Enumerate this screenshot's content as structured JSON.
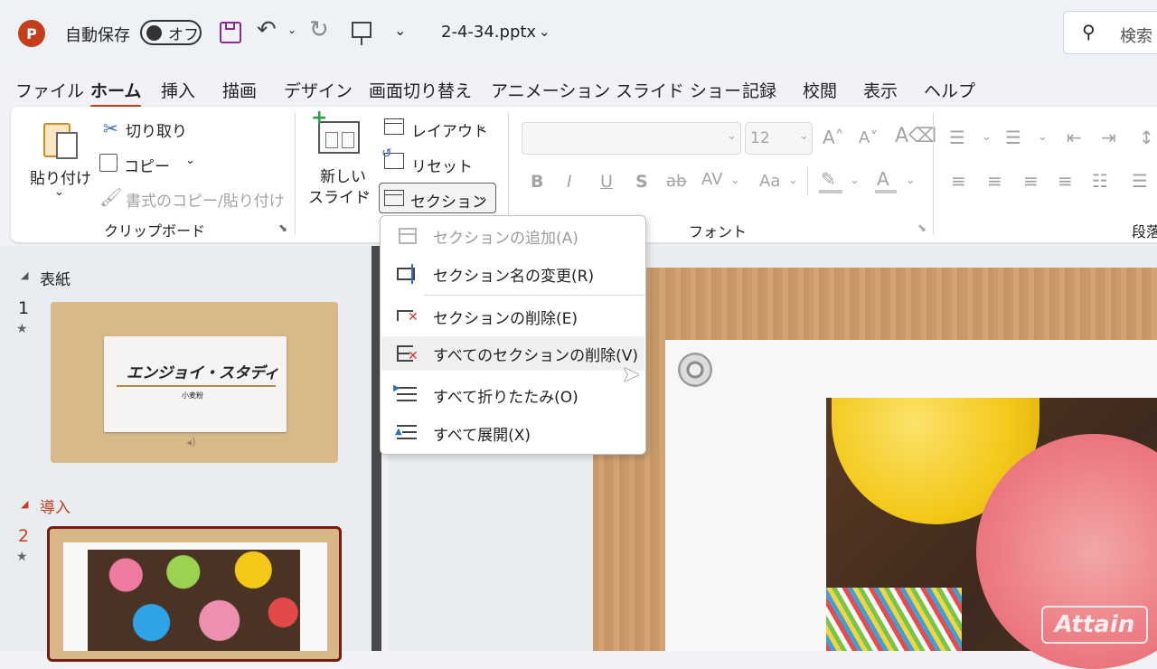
{
  "titlebar": {
    "app_icon_letter": "P",
    "autosave_label": "自動保存",
    "autosave_toggle": "オフ",
    "filename": "2-4-34.pptx",
    "search_label": "検索"
  },
  "tabs": [
    "ファイル",
    "ホーム",
    "挿入",
    "描画",
    "デザイン",
    "画面切り替え",
    "アニメーション",
    "スライド ショー",
    "記録",
    "校閲",
    "表示",
    "ヘルプ"
  ],
  "ribbon": {
    "clipboard": {
      "paste": "貼り付け",
      "cut": "切り取り",
      "copy": "コピー",
      "format_painter": "書式のコピー/貼り付け",
      "group_label": "クリップボード"
    },
    "slides": {
      "new_slide_line1": "新しい",
      "new_slide_line2": "スライド",
      "layout": "レイアウト",
      "reset": "リセット",
      "section": "セクション"
    },
    "font": {
      "font_name": "",
      "font_size": "12",
      "group_label": "フォント",
      "bold": "B",
      "italic": "I",
      "underline": "U",
      "shadow": "S",
      "strike": "ab",
      "spacing": "AV",
      "case": "Aa"
    },
    "paragraph_label": "段落"
  },
  "section_menu": {
    "items": [
      {
        "label": "セクションの追加(A)",
        "icon": "add-section-icon",
        "disabled": true
      },
      {
        "label": "セクション名の変更(R)",
        "icon": "rename-section-icon",
        "disabled": false
      },
      {
        "label": "セクションの削除(E)",
        "icon": "delete-section-icon",
        "disabled": false
      },
      {
        "label": "すべてのセクションの削除(V)",
        "icon": "delete-all-sections-icon",
        "disabled": false,
        "hover": true
      },
      {
        "label": "すべて折りたたみ(O)",
        "icon": "collapse-all-icon",
        "disabled": false
      },
      {
        "label": "すべて展開(X)",
        "icon": "expand-all-icon",
        "disabled": false
      }
    ]
  },
  "slide_pane": {
    "section1": "表紙",
    "slide1_number": "1",
    "slide1_title": "エンジョイ・スタディ",
    "slide1_subtitle": "小麦粉",
    "section2": "導入",
    "slide2_number": "2",
    "star": "★"
  },
  "watermark": "Attain",
  "colors": {
    "accent": "#c43e1c",
    "section_color": "#c43e1c",
    "selected_slide_border": "#7a1b12"
  }
}
